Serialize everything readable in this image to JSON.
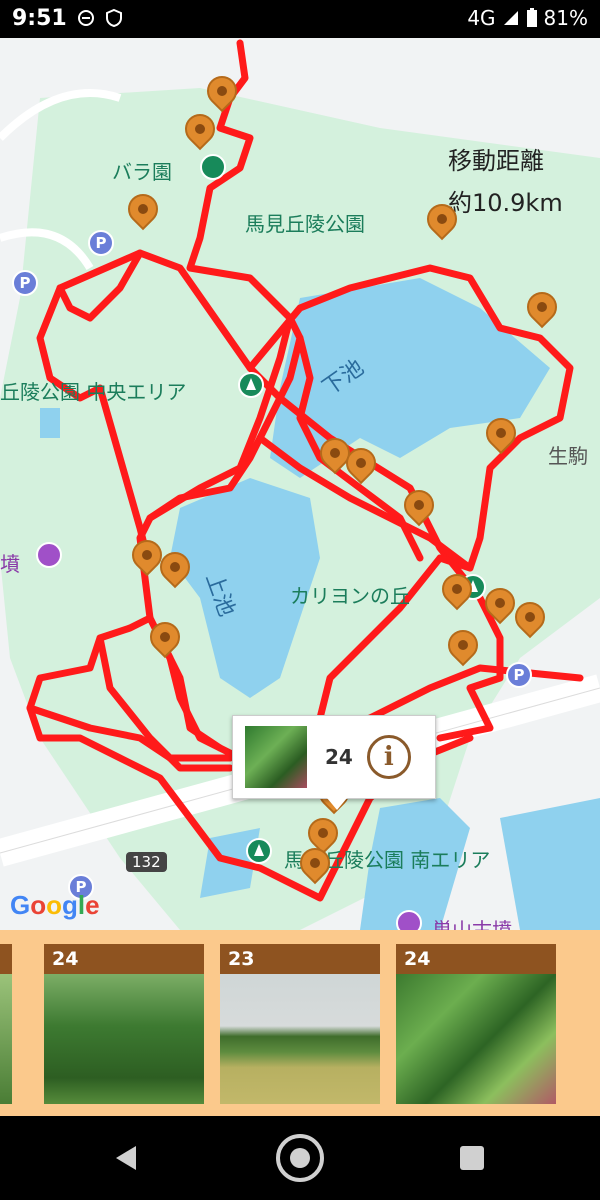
{
  "status_bar": {
    "time": "9:51",
    "network": "4G",
    "battery": "81%"
  },
  "map": {
    "labels": {
      "rose_garden": "バラ園",
      "park_name": "馬見丘陵公園",
      "central_area": "丘陵公園 中央エリア",
      "lower_pond": "下池",
      "upper_pond": "上池",
      "carillon": "カリヨンの丘",
      "south_area": "馬見丘陵公園 南エリア",
      "tomb_left": "墳",
      "tomb_bottom": "巣山古墳",
      "ikoma": "生駒",
      "road": "132"
    },
    "distance": {
      "label": "移動距離",
      "value": "約10.9km"
    },
    "popup": {
      "count": "24",
      "info_icon": "i"
    },
    "google": [
      "G",
      "o",
      "o",
      "g",
      "l",
      "e"
    ]
  },
  "photo_strip": {
    "cards": [
      {
        "count": "24",
        "image": "forest-photo"
      },
      {
        "count": "23",
        "image": "field-photo"
      },
      {
        "count": "24",
        "image": "maple-photo"
      }
    ]
  },
  "colors": {
    "route": "#ff1a1a",
    "pin": "#e08a2d",
    "strip_bg": "#fbc98c",
    "card_header": "#8e5320"
  }
}
